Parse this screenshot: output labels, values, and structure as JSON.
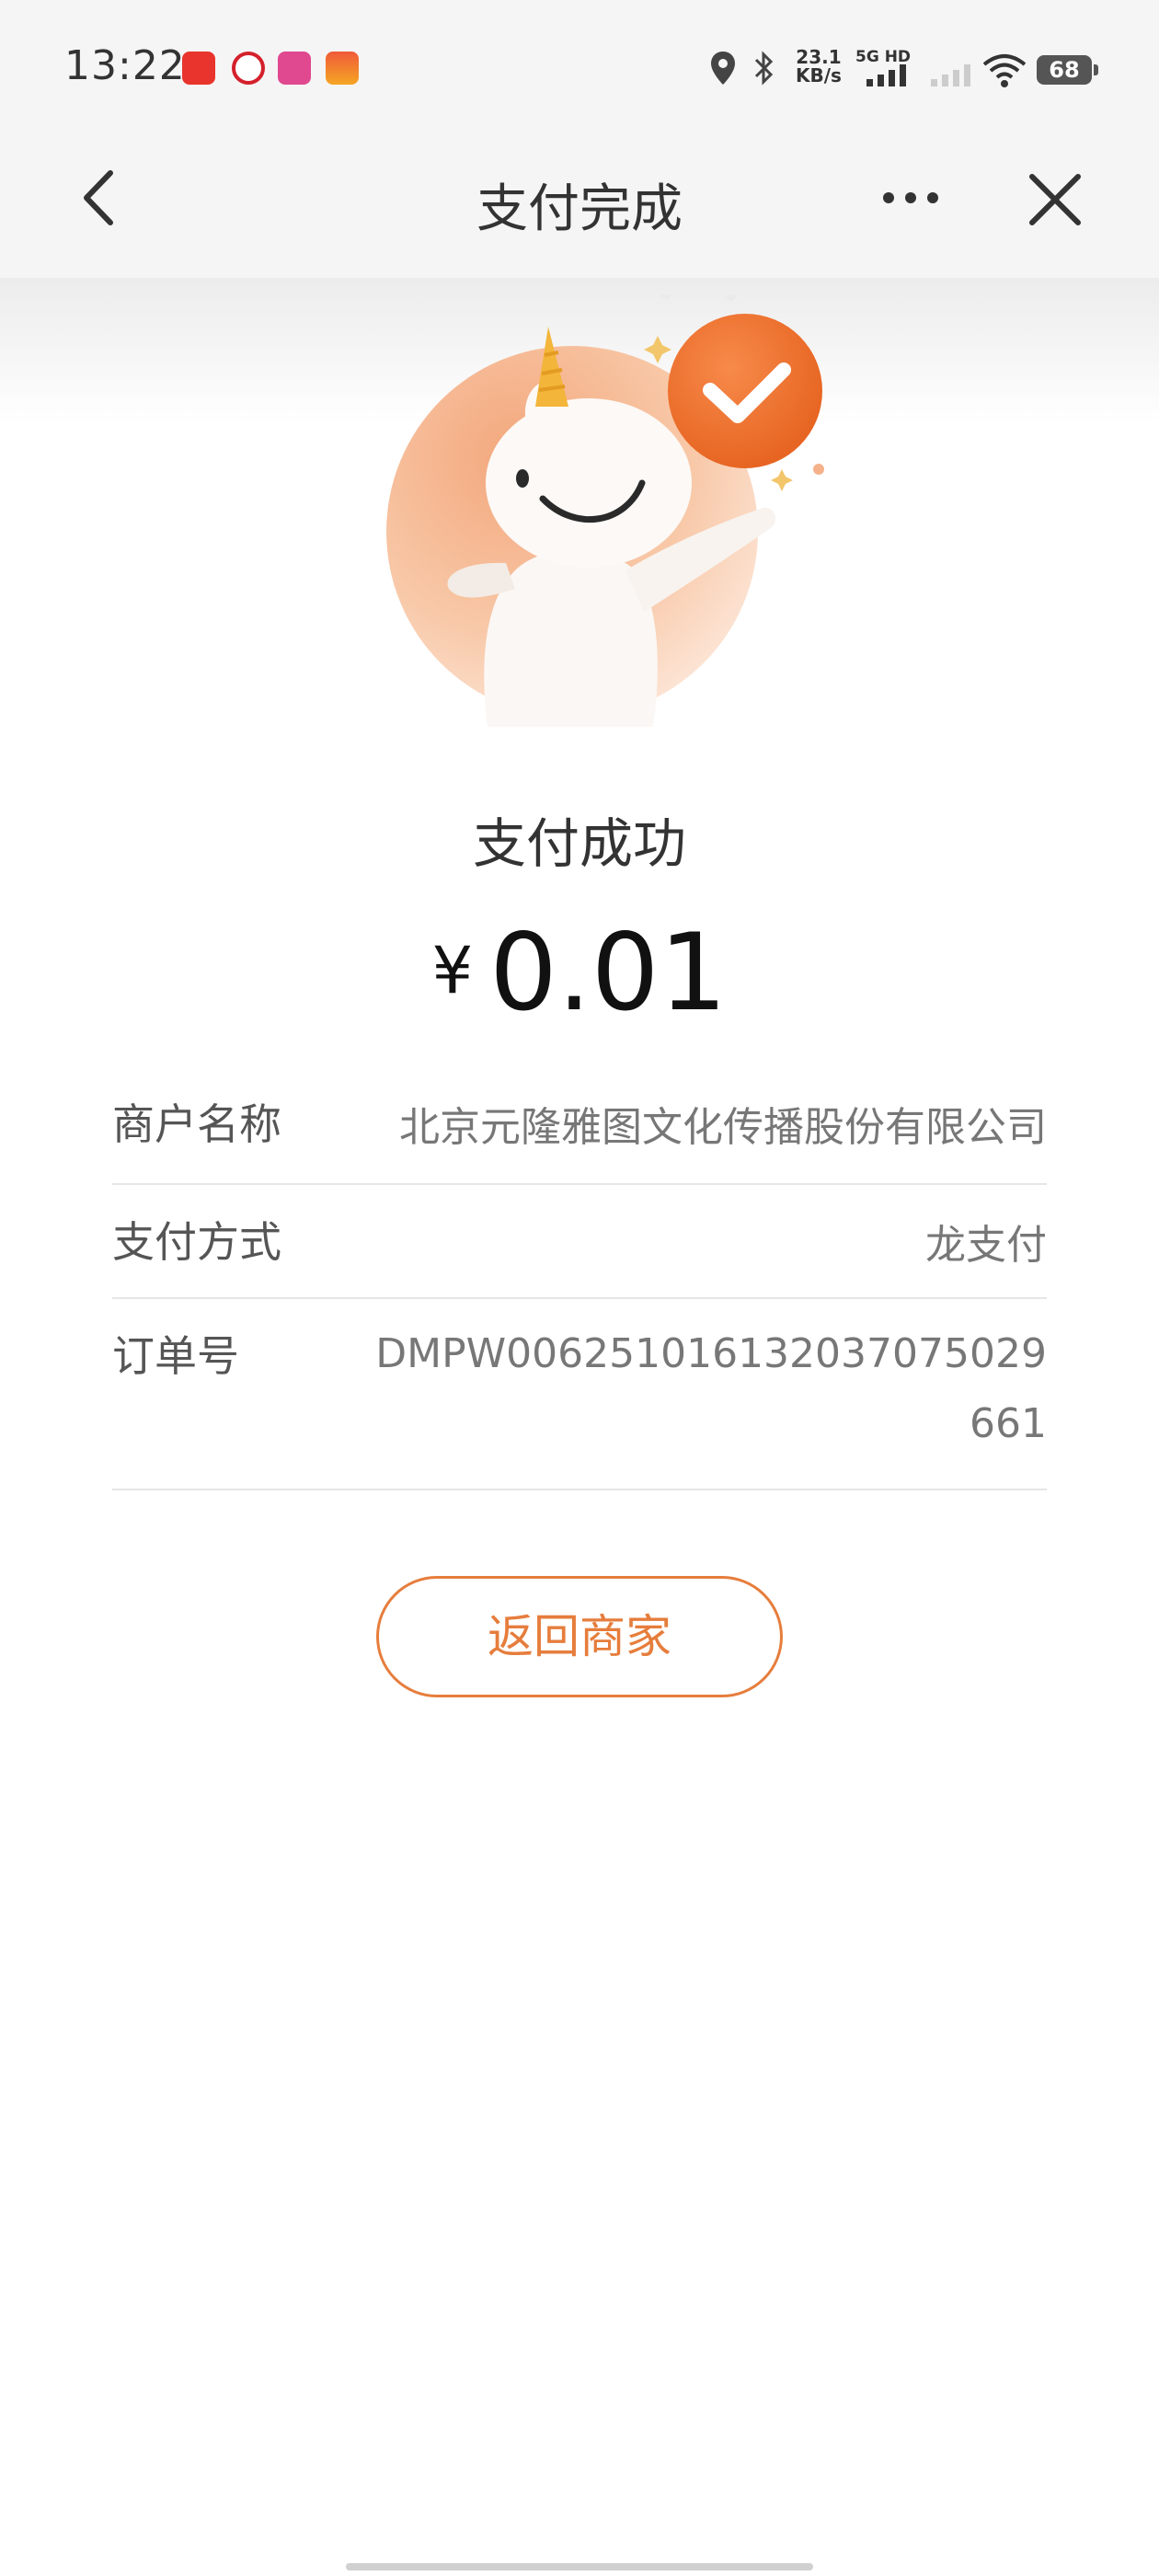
{
  "status_bar": {
    "time": "13:22",
    "app_icons": [
      "toutiao-app-icon",
      "cmb-app-icon",
      "bilibili-app-icon",
      "game-app-icon"
    ],
    "net_speed_value": "23.1",
    "net_speed_unit": "KB/s",
    "network_label": "5G HD",
    "battery": "68"
  },
  "nav": {
    "title": "支付完成",
    "back_icon": "chevron-left-icon",
    "more_icon": "more-horizontal-icon",
    "close_icon": "close-icon"
  },
  "result": {
    "title": "支付成功",
    "currency": "¥",
    "amount": "0.01"
  },
  "details": [
    {
      "label": "商户名称",
      "value": "北京元隆雅图文化传播股份有限公司"
    },
    {
      "label": "支付方式",
      "value": "龙支付"
    },
    {
      "label": "订单号",
      "value": "DMPW006251016132037075029661"
    }
  ],
  "actions": {
    "back_to_merchant": "返回商家"
  },
  "colors": {
    "accent": "#e67d3c",
    "nav_background": "#f5f5f5"
  }
}
